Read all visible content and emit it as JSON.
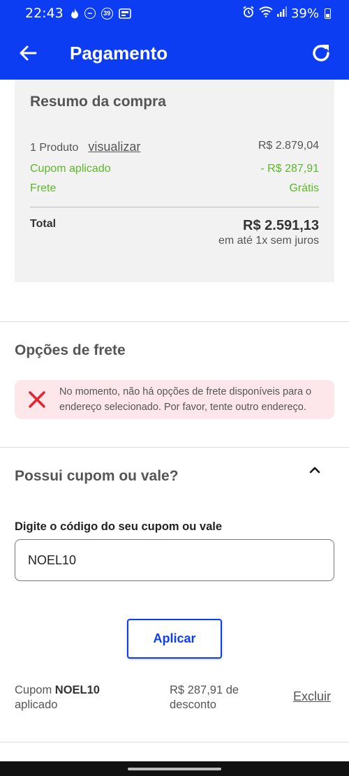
{
  "status_bar": {
    "time": "22:43",
    "notification_badge": "39",
    "battery": "39%"
  },
  "header": {
    "title": "Pagamento",
    "back_icon": "arrow-left-icon",
    "refresh_icon": "refresh-icon"
  },
  "summary": {
    "title": "Resumo da compra",
    "products_label": "1 Produto",
    "view_link": "visualizar",
    "products_value": "R$ 2.879,04",
    "coupon_label": "Cupom aplicado",
    "coupon_value": "- R$ 287,91",
    "shipping_label": "Frete",
    "shipping_value": "Grátis",
    "total_label": "Total",
    "total_value": "R$ 2.591,13",
    "installments": "em até 1x sem juros"
  },
  "shipping": {
    "title": "Opções de frete",
    "error_line1": "No momento, não há opções de frete disponíveis para o",
    "error_line2": "endereço selecionado. Por favor, tente outro endereço."
  },
  "coupon": {
    "title": "Possui cupom ou vale?",
    "field_label": "Digite o código do seu cupom ou vale",
    "field_value": "NOEL10",
    "apply_label": "Aplicar",
    "applied_prefix": "Cupom",
    "applied_code": "NOEL10",
    "applied_suffix": "aplicado",
    "discount_line1": "R$ 287,91 de",
    "discount_line2": "desconto",
    "remove_label": "Excluir"
  },
  "colors": {
    "brand_blue": "#0d3df2",
    "success_green": "#5cb827",
    "error_red": "#e5232f",
    "error_bg": "#fde7ea"
  }
}
